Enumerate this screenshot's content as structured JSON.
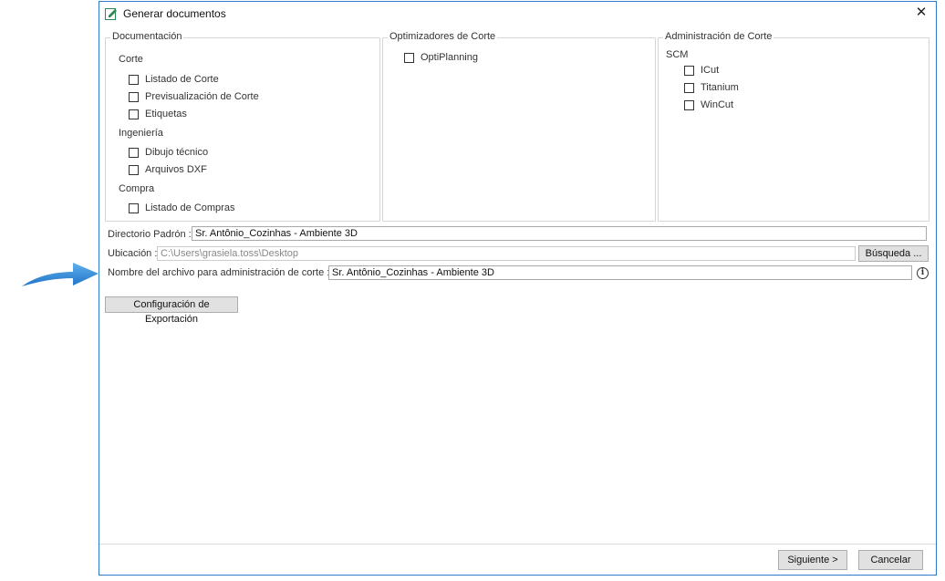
{
  "window": {
    "title": "Generar documentos"
  },
  "documentacion": {
    "legend": "Documentación",
    "corte": {
      "label": "Corte",
      "items": [
        "Listado de Corte",
        "Previsualización de Corte",
        "Etiquetas"
      ]
    },
    "ingenieria": {
      "label": "Ingeniería",
      "items": [
        "Dibujo técnico",
        "Arquivos DXF"
      ]
    },
    "compra": {
      "label": "Compra",
      "items": [
        "Listado de Compras"
      ]
    }
  },
  "optimizadores": {
    "legend": "Optimizadores de Corte",
    "items": [
      "OptiPlanning"
    ]
  },
  "administracion": {
    "legend": "Administración de Corte",
    "scm_label": "SCM",
    "items": [
      "ICut",
      "Titanium",
      "WinCut"
    ]
  },
  "directorio": {
    "label": "Directorio Padrón :",
    "value": "Sr. Antônio_Cozinhas - Ambiente 3D"
  },
  "ubicacion": {
    "label": "Ubicación :",
    "value": "C:\\Users\\grasiela.toss\\Desktop",
    "search_button": "Búsqueda ..."
  },
  "nombre_archivo": {
    "label": "Nombre del archivo para administración de corte :",
    "value": "Sr. Antônio_Cozinhas - Ambiente 3D"
  },
  "config_button": "Configuración de Exportación",
  "footer": {
    "next_button": "Siguiente >",
    "cancel_button": "Cancelar"
  },
  "colors": {
    "arrow": "#2e86d6",
    "window_border": "#2b79c9"
  }
}
